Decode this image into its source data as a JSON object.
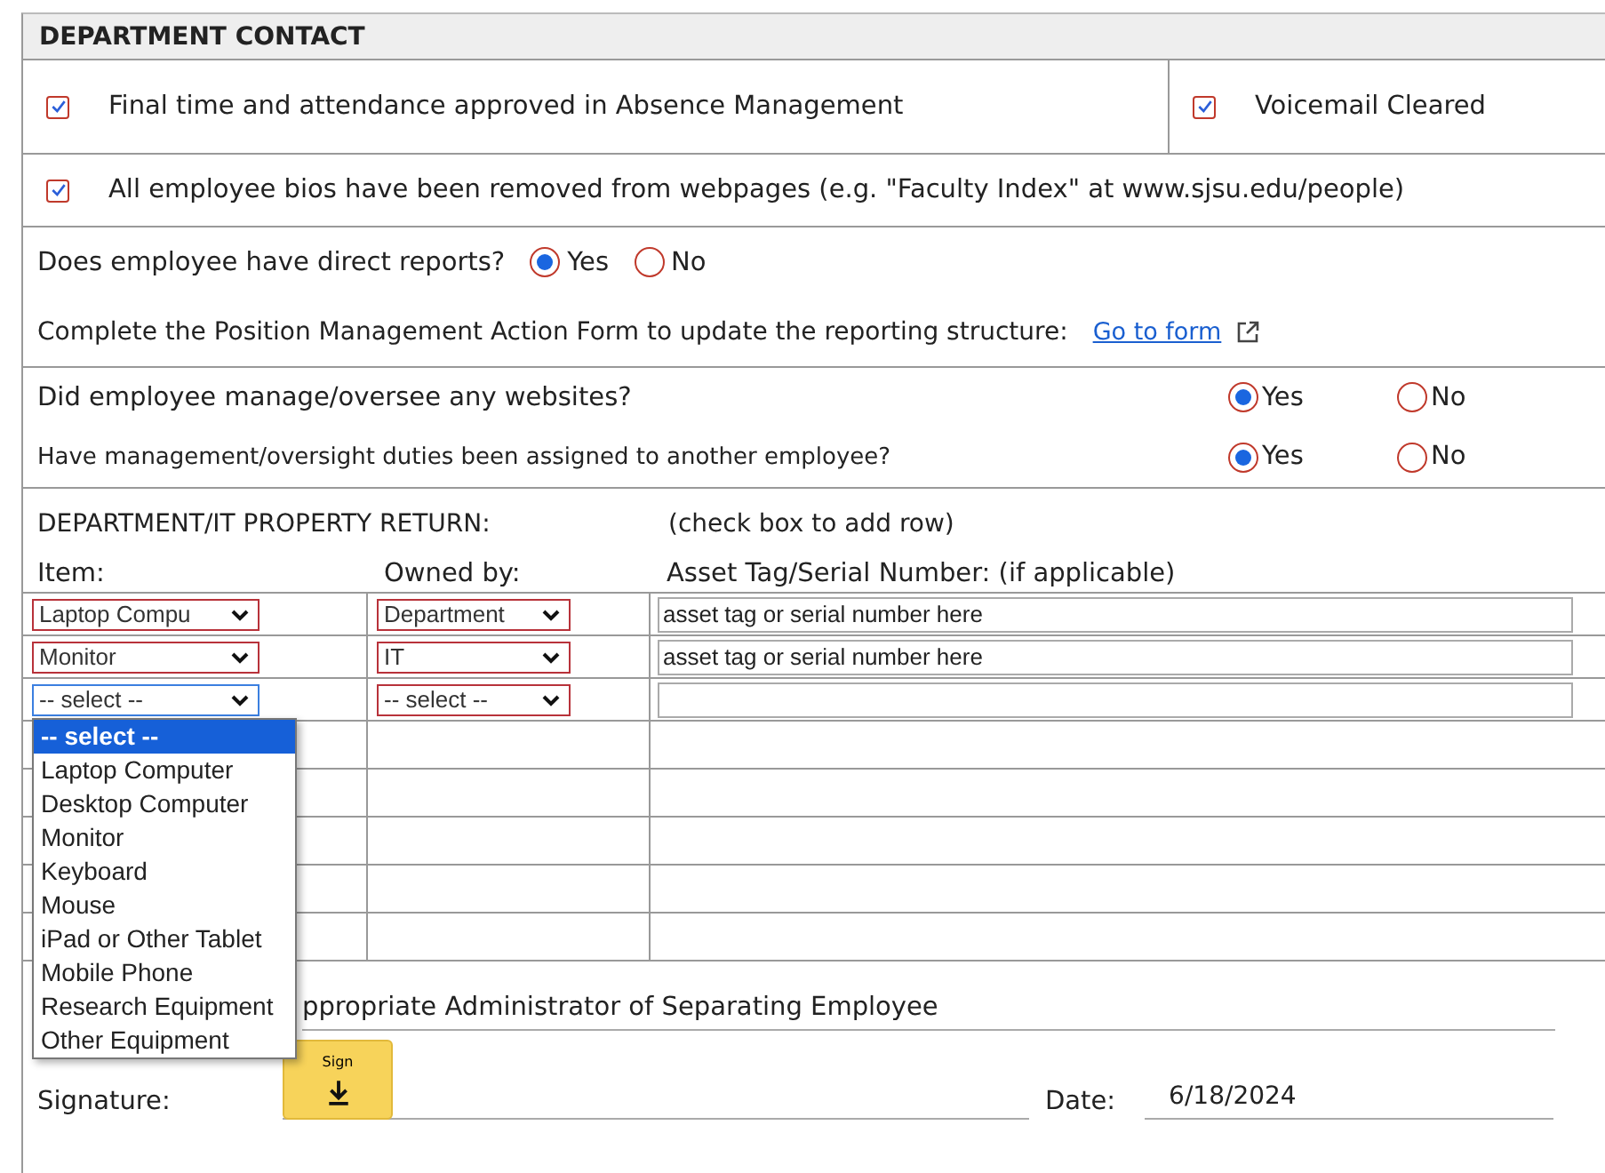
{
  "section_title": "DEPARTMENT CONTACT",
  "checklist_rows": [
    {
      "items": [
        {
          "label": "Final time and attendance approved in Absence Management",
          "checked": true
        },
        {
          "label": "Voicemail Cleared",
          "checked": true
        }
      ]
    },
    {
      "items": [
        {
          "label": "All employee bios have been removed from webpages (e.g. \"Faculty Index\" at www.sjsu.edu/people)",
          "checked": true
        }
      ]
    }
  ],
  "direct_reports": {
    "question": "Does employee have direct reports?",
    "options": [
      {
        "label": "Yes",
        "selected": true
      },
      {
        "label": "No",
        "selected": false
      }
    ]
  },
  "position_note": {
    "text": "Complete the Position Management Action Form to update the reporting structure:",
    "link": "Go to form"
  },
  "website_questions": [
    {
      "question": "Did employee manage/oversee any websites?",
      "options": [
        {
          "label": "Yes",
          "selected": true
        },
        {
          "label": "No",
          "selected": false
        }
      ]
    },
    {
      "question": "Have management/oversight duties been assigned to another employee?",
      "options": [
        {
          "label": "Yes",
          "selected": true
        },
        {
          "label": "No",
          "selected": false
        }
      ]
    }
  ],
  "property_return": {
    "title": "DEPARTMENT/IT PROPERTY RETURN:",
    "hint": "(check box to add row)",
    "columns": [
      "Item:",
      "Owned by:",
      "Asset Tag/Serial Number: (if applicable)"
    ],
    "rows": [
      {
        "kind": "entry",
        "item": "Laptop Compu",
        "owner": "Department",
        "asset": "asset tag or serial number here",
        "open": false
      },
      {
        "kind": "entry",
        "item": "Monitor",
        "owner": "IT",
        "asset": "asset tag or serial number here",
        "open": false
      },
      {
        "kind": "entry",
        "item": "-- select --",
        "owner": "-- select --",
        "open": true
      },
      {
        "kind": "blank"
      },
      {
        "kind": "blank"
      },
      {
        "kind": "blank"
      },
      {
        "kind": "blank"
      },
      {
        "kind": "blank"
      }
    ],
    "open_list": [
      {
        "label": "-- select --",
        "selected": true
      },
      {
        "label": "Laptop Computer",
        "selected": false
      },
      {
        "label": "Desktop Computer",
        "selected": false
      },
      {
        "label": "Monitor",
        "selected": false
      },
      {
        "label": "Keyboard",
        "selected": false
      },
      {
        "label": "Mouse",
        "selected": false
      },
      {
        "label": "iPad or Other Tablet",
        "selected": false
      },
      {
        "label": "Mobile Phone",
        "selected": false
      },
      {
        "label": "Research Equipment",
        "selected": false
      },
      {
        "label": "Other Equipment",
        "selected": false
      }
    ]
  },
  "signoff": {
    "caption": "ppropriate Administrator of Separating Employee",
    "signature_label": "Signature:",
    "sign_button": "Sign",
    "date_label": "Date:",
    "date": "6/18/2024"
  }
}
